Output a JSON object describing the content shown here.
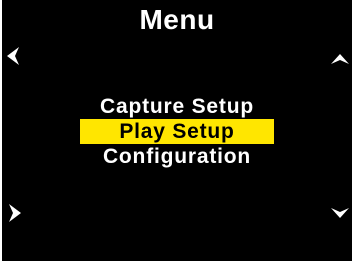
{
  "header": {
    "title": "Menu"
  },
  "menu": {
    "items": [
      {
        "label": "Capture Setup",
        "selected": false
      },
      {
        "label": "Play Setup",
        "selected": true
      },
      {
        "label": "Configuration",
        "selected": false
      }
    ]
  },
  "nav": {
    "left_icon": "chevron-left-icon",
    "up_icon": "chevron-up-icon",
    "right_icon": "chevron-right-icon",
    "down_icon": "chevron-down-icon"
  },
  "colors": {
    "background": "#000000",
    "text": "#ffffff",
    "highlight": "#ffe600",
    "highlight_text": "#000000"
  }
}
